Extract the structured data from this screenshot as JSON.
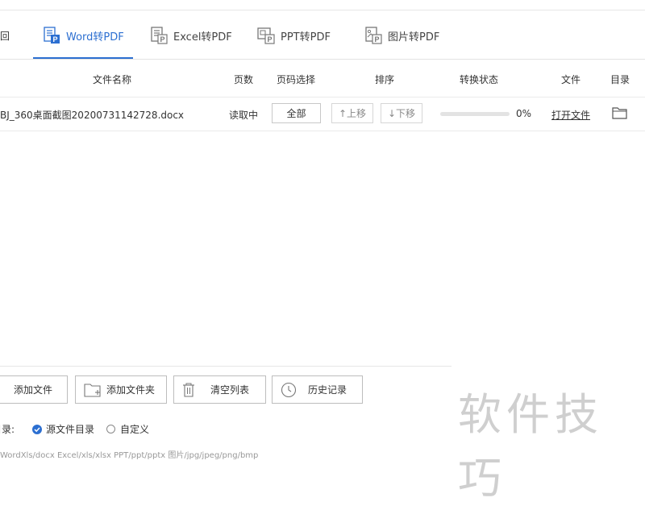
{
  "nav": {
    "back_label": "返回",
    "tabs": [
      {
        "label": "Word转PDF",
        "active": true
      },
      {
        "label": "Excel转PDF",
        "active": false
      },
      {
        "label": "PPT转PDF",
        "active": false
      },
      {
        "label": "图片转PDF",
        "active": false
      }
    ]
  },
  "table": {
    "headers": {
      "filename": "文件名称",
      "pages": "页数",
      "page_select": "页码选择",
      "sort": "排序",
      "status": "转换状态",
      "file": "文件",
      "dir": "目录"
    },
    "rows": [
      {
        "filename": "BJ_360桌面截图20200731142728.docx",
        "pages": "读取中",
        "page_select": "全部",
        "move_up": "↑上移",
        "move_down": "↓下移",
        "progress": 0,
        "progress_label": "0%",
        "open_file": "打开文件"
      }
    ]
  },
  "actions": {
    "add_file": "添加文件",
    "add_folder": "添加文件夹",
    "clear_list": "清空列表",
    "history": "历史记录"
  },
  "output": {
    "label": "目录:",
    "option_source": "源文件目录",
    "option_custom": "自定义"
  },
  "footer_text": "WordXls/docx  Excel/xls/xlsx  PPT/ppt/pptx  图片/jpg/jpeg/png/bmp",
  "watermark": "软件技巧",
  "colors": {
    "accent": "#2c6fd1"
  }
}
